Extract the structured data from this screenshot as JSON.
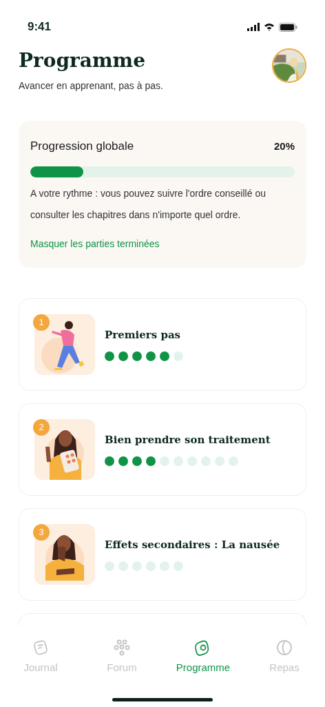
{
  "status_bar": {
    "time": "9:41"
  },
  "header": {
    "title": "Programme",
    "subtitle": "Avancer en apprenant, pas à pas."
  },
  "progress_card": {
    "title": "Progression globale",
    "percent": "20%",
    "level": 0.2,
    "description": "A votre rythme : vous pouvez suivre l'ordre conseillé ou consulter les chapitres dans n'importe quel ordre.",
    "link": "Masquer les parties terminées"
  },
  "chapters": [
    {
      "number": "1",
      "title": "Premiers pas",
      "steps": [
        {
          "done": true
        },
        {
          "done": true
        },
        {
          "done": true
        },
        {
          "done": true
        },
        {
          "done": true
        },
        {
          "done": false
        }
      ]
    },
    {
      "number": "2",
      "title": "Bien prendre son traitement",
      "steps": [
        {
          "done": true
        },
        {
          "done": true
        },
        {
          "done": true
        },
        {
          "done": true
        },
        {
          "done": false
        },
        {
          "done": false
        },
        {
          "done": false
        },
        {
          "done": false
        },
        {
          "done": false
        },
        {
          "done": false
        }
      ]
    },
    {
      "number": "3",
      "title": "Effets secondaires : La nausée",
      "steps": [
        {
          "done": false
        },
        {
          "done": false
        },
        {
          "done": false
        },
        {
          "done": false
        },
        {
          "done": false
        },
        {
          "done": false
        }
      ]
    }
  ],
  "tab_bar": [
    {
      "label": "Journal",
      "selected": false
    },
    {
      "label": "Forum",
      "selected": false
    },
    {
      "label": "Programme",
      "selected": true
    },
    {
      "label": "Repas",
      "selected": false
    }
  ]
}
